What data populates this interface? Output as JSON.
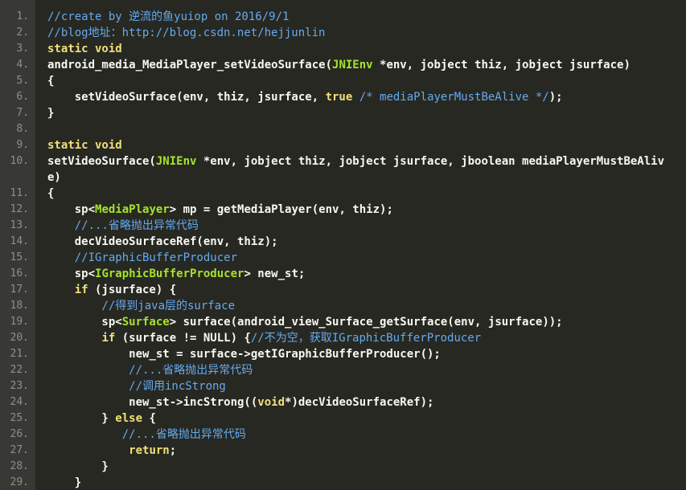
{
  "colors": {
    "background": "#272822",
    "gutter_background": "#383834",
    "gutter_text": "#8f908a",
    "plain": "#f8f8f2",
    "keyword": "#f0e07a",
    "comment": "#66aaee",
    "type": "#a6e22e"
  },
  "lines": [
    {
      "num": "1.",
      "tokens": [
        {
          "t": "//create by 逆流的鱼yuiop on 2016/9/1",
          "k": "c"
        }
      ]
    },
    {
      "num": "2.",
      "tokens": [
        {
          "t": "//blog地址：http://blog.csdn.net/hejjunlin",
          "k": "c"
        }
      ]
    },
    {
      "num": "3.",
      "tokens": [
        {
          "t": "static void",
          "k": "k"
        }
      ]
    },
    {
      "num": "4.",
      "tokens": [
        {
          "t": "android_media_MediaPlayer_setVideoSurface(",
          "k": "p"
        },
        {
          "t": "JNIEnv",
          "k": "t"
        },
        {
          "t": " *env, jobject thiz, jobject jsurface)",
          "k": "p"
        }
      ]
    },
    {
      "num": "5.",
      "tokens": [
        {
          "t": "{",
          "k": "p"
        }
      ]
    },
    {
      "num": "6.",
      "tokens": [
        {
          "t": "    setVideoSurface(env, thiz, jsurface, ",
          "k": "p"
        },
        {
          "t": "true",
          "k": "k"
        },
        {
          "t": " ",
          "k": "p"
        },
        {
          "t": "/* mediaPlayerMustBeAlive */",
          "k": "c"
        },
        {
          "t": ");",
          "k": "p"
        }
      ]
    },
    {
      "num": "7.",
      "tokens": [
        {
          "t": "}",
          "k": "p"
        }
      ]
    },
    {
      "num": "8.",
      "tokens": []
    },
    {
      "num": "9.",
      "tokens": [
        {
          "t": "static void",
          "k": "k"
        }
      ]
    },
    {
      "num": "10.",
      "wrap": true,
      "tokens": [
        {
          "t": "setVideoSurface(",
          "k": "p"
        },
        {
          "t": "JNIEnv",
          "k": "t"
        },
        {
          "t": " *env, jobject thiz, jobject jsurface, jboolean mediaPlayerMustBeAliv\ne)",
          "k": "p"
        }
      ]
    },
    {
      "num": "11.",
      "tokens": [
        {
          "t": "{",
          "k": "p"
        }
      ]
    },
    {
      "num": "12.",
      "tokens": [
        {
          "t": "    sp<",
          "k": "p"
        },
        {
          "t": "MediaPlayer",
          "k": "t"
        },
        {
          "t": "> mp = getMediaPlayer(env, thiz);",
          "k": "p"
        }
      ]
    },
    {
      "num": "13.",
      "tokens": [
        {
          "t": "    //...省略抛出异常代码",
          "k": "c"
        }
      ]
    },
    {
      "num": "14.",
      "tokens": [
        {
          "t": "    decVideoSurfaceRef(env, thiz);",
          "k": "p"
        }
      ]
    },
    {
      "num": "15.",
      "tokens": [
        {
          "t": "    //IGraphicBufferProducer",
          "k": "c"
        }
      ]
    },
    {
      "num": "16.",
      "tokens": [
        {
          "t": "    sp<",
          "k": "p"
        },
        {
          "t": "IGraphicBufferProducer",
          "k": "t"
        },
        {
          "t": "> new_st;",
          "k": "p"
        }
      ]
    },
    {
      "num": "17.",
      "tokens": [
        {
          "t": "    ",
          "k": "p"
        },
        {
          "t": "if",
          "k": "k"
        },
        {
          "t": " (jsurface) {",
          "k": "p"
        }
      ]
    },
    {
      "num": "18.",
      "tokens": [
        {
          "t": "        //得到java层的surface",
          "k": "c"
        }
      ]
    },
    {
      "num": "19.",
      "tokens": [
        {
          "t": "        sp<",
          "k": "p"
        },
        {
          "t": "Surface",
          "k": "t"
        },
        {
          "t": "> surface(android_view_Surface_getSurface(env, jsurface));",
          "k": "p"
        }
      ]
    },
    {
      "num": "20.",
      "tokens": [
        {
          "t": "        ",
          "k": "p"
        },
        {
          "t": "if",
          "k": "k"
        },
        {
          "t": " (surface != NULL) {",
          "k": "p"
        },
        {
          "t": "//不为空，获取IGraphicBufferProducer",
          "k": "c"
        }
      ]
    },
    {
      "num": "21.",
      "tokens": [
        {
          "t": "            new_st = surface->getIGraphicBufferProducer();",
          "k": "p"
        }
      ]
    },
    {
      "num": "22.",
      "tokens": [
        {
          "t": "            //...省略抛出异常代码",
          "k": "c"
        }
      ]
    },
    {
      "num": "23.",
      "tokens": [
        {
          "t": "            //调用incStrong",
          "k": "c"
        }
      ]
    },
    {
      "num": "24.",
      "tokens": [
        {
          "t": "            new_st->incStrong((",
          "k": "p"
        },
        {
          "t": "void",
          "k": "k"
        },
        {
          "t": "*)decVideoSurfaceRef);",
          "k": "p"
        }
      ]
    },
    {
      "num": "25.",
      "tokens": [
        {
          "t": "        } ",
          "k": "p"
        },
        {
          "t": "else",
          "k": "k"
        },
        {
          "t": " {",
          "k": "p"
        }
      ]
    },
    {
      "num": "26.",
      "tokens": [
        {
          "t": "           //...省略抛出异常代码",
          "k": "c"
        }
      ]
    },
    {
      "num": "27.",
      "tokens": [
        {
          "t": "            ",
          "k": "p"
        },
        {
          "t": "return",
          "k": "k"
        },
        {
          "t": ";",
          "k": "p"
        }
      ]
    },
    {
      "num": "28.",
      "tokens": [
        {
          "t": "        }",
          "k": "p"
        }
      ]
    },
    {
      "num": "29.",
      "tokens": [
        {
          "t": "    }",
          "k": "p"
        }
      ]
    }
  ]
}
